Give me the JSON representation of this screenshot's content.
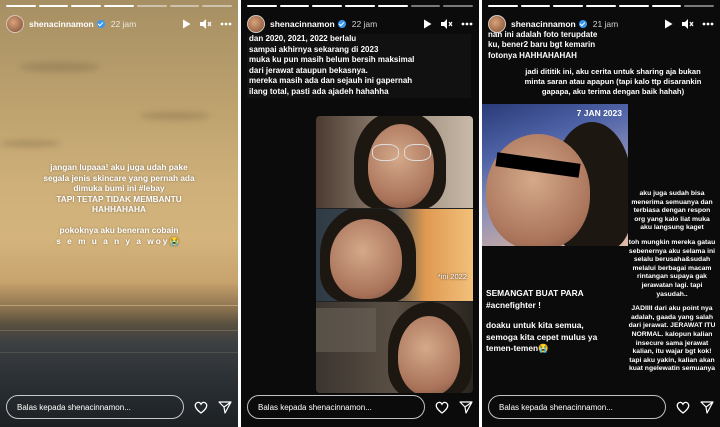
{
  "panels": [
    {
      "username": "shenacinnamon",
      "time": "22 jam",
      "text_lines": [
        "jangan lupaaa! aku juga udah pake",
        "segala jenis skincare yang pernah ada",
        "dimuka bumi ini #lebay",
        "TAPI TETAP TIDAK MEMBANTU",
        "HAHHAHAHA",
        "pokoknya aku beneran cobain",
        "s e m u a n y a woy😭"
      ],
      "reply_placeholder": "Balas kepada shenacinnamon..."
    },
    {
      "username": "shenacinnamon",
      "time": "22 jam",
      "text_lines": [
        "dan 2020, 2021, 2022 berlalu",
        "sampai akhirnya sekarang di 2023",
        "muka ku pun masih belum bersih maksimal",
        "dari jerawat ataupun bekasnya.",
        "mereka masih ada dan sejauh ini gapernah",
        "ilang total, pasti ada ajadeh hahahha"
      ],
      "photo_label": "*ini 2022",
      "reply_placeholder": "Balas kepada shenacinnamon..."
    },
    {
      "username": "shenacinnamon",
      "time": "21 jam",
      "top_lines": [
        "nah ini adalah foto terupdate",
        "ku, bener2 baru bgt kemarin",
        "fotonya HAHHAHAHAH"
      ],
      "mid_lines": [
        "jadi dititik ini, aku cerita untuk sharing aja bukan",
        "minta saran atau apapun (tapi kalo ttp disarankin",
        "gapapa, aku terima dengan baik hahah)"
      ],
      "photo_date": "7 JAN 2023",
      "right_paragraphs": [
        "aku juga sudah bisa menerima semuanya dan terbiasa dengan respon org yang kalo liat muka aku langsung kaget",
        "toh mungkin mereka gatau sebenernya aku selama ini selalu berusaha&sudah melalui berbagai macam rintangan supaya gak jerawatan lagi. tapi yasudah..",
        "JADIIII dari aku point nya adalah, gaada yang salah dari jerawat. JERAWAT ITU NORMAL. kalopun kalian insecure sama jerawat kalian, itu wajar bgt kok! tapi aku yakin, kalian akan kuat ngelewatin semuanya"
      ],
      "left_paragraphs": [
        "SEMANGAT BUAT PARA #acnefighter !",
        "doaku untuk kita semua, semoga kita cepet mulus ya temen-temen😭"
      ],
      "reply_placeholder": "Balas kepada shenacinnamon..."
    }
  ],
  "colors": {
    "verified": "#3897f0",
    "story_bg": "#0b0b0b"
  },
  "icons": [
    "play-icon",
    "mute-icon",
    "more-icon",
    "heart-icon",
    "send-icon",
    "verified-icon"
  ]
}
